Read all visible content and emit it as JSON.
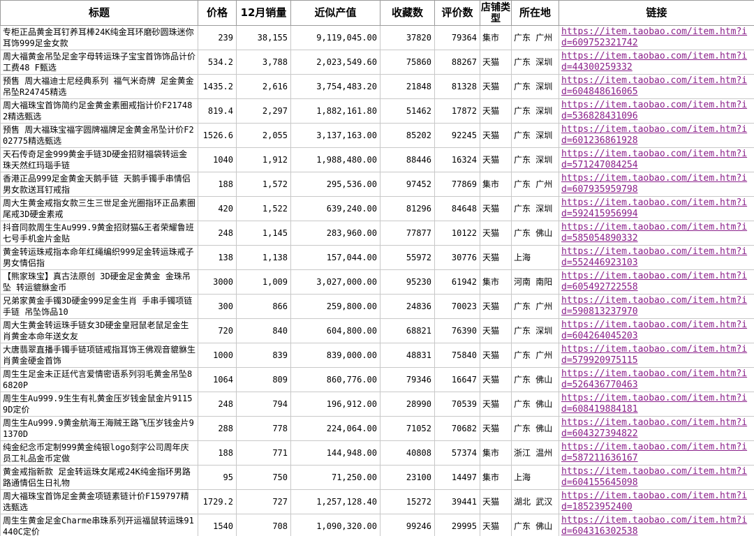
{
  "headers": [
    "标题",
    "价格",
    "12月销量",
    "近似产值",
    "收藏数",
    "评价数",
    "店铺类型",
    "所在地",
    "链接"
  ],
  "rows": [
    {
      "title": "专柜正品黄金耳钉养耳棒24K纯金耳环磨砂圆珠迷你耳饰999足金女款",
      "price": "239",
      "sales": "38,155",
      "value": "9,119,045.00",
      "fav": "37820",
      "reviews": "79364",
      "type": "集市",
      "loc": "广东 广州",
      "link": "https://item.taobao.com/item.htm?id=609752321742"
    },
    {
      "title": "周大福黄金吊坠足金字母转运珠子宝宝首饰饰品计价工费48 F甄选",
      "price": "534.2",
      "sales": "3,788",
      "value": "2,023,549.60",
      "fav": "75860",
      "reviews": "88267",
      "type": "天猫",
      "loc": "广东 深圳",
      "link": "https://item.taobao.com/item.htm?id=44300259332"
    },
    {
      "title": "预售 周大福迪士尼经典系列 福气米奇牌 足金黄金吊坠R24745精选",
      "price": "1435.2",
      "sales": "2,616",
      "value": "3,754,483.20",
      "fav": "21848",
      "reviews": "81328",
      "type": "天猫",
      "loc": "广东 深圳",
      "link": "https://item.taobao.com/item.htm?id=604848616065"
    },
    {
      "title": "周大福珠宝首饰简约足金黄金素圈戒指计价F217482精选甄选",
      "price": "819.4",
      "sales": "2,297",
      "value": "1,882,161.80",
      "fav": "51462",
      "reviews": "17872",
      "type": "天猫",
      "loc": "广东 深圳",
      "link": "https://item.taobao.com/item.htm?id=536828431096"
    },
    {
      "title": "预售 周大福珠宝福字圆牌福牌足金黄金吊坠计价F202775精选甄选",
      "price": "1526.6",
      "sales": "2,055",
      "value": "3,137,163.00",
      "fav": "85202",
      "reviews": "92245",
      "type": "天猫",
      "loc": "广东 深圳",
      "link": "https://item.taobao.com/item.htm?id=601236861928"
    },
    {
      "title": "天石传奇足金999黄金手链3D硬金招财福袋转运金珠天然红玛瑙手链",
      "price": "1040",
      "sales": "1,912",
      "value": "1,988,480.00",
      "fav": "88446",
      "reviews": "16324",
      "type": "天猫",
      "loc": "广东 深圳",
      "link": "https://item.taobao.com/item.htm?id=571247084254"
    },
    {
      "title": "香港正品999足金黄金天鹅手链 天鹅手镯手串情侣男女款送耳钉戒指",
      "price": "188",
      "sales": "1,572",
      "value": "295,536.00",
      "fav": "97452",
      "reviews": "77869",
      "type": "集市",
      "loc": "广东 广州",
      "link": "https://item.taobao.com/item.htm?id=607935959798"
    },
    {
      "title": "周大生黄金戒指女款三生三世足金光圈指环正品素圈尾戒3D硬金素戒",
      "price": "420",
      "sales": "1,522",
      "value": "639,240.00",
      "fav": "81296",
      "reviews": "84648",
      "type": "天猫",
      "loc": "广东 深圳",
      "link": "https://item.taobao.com/item.htm?id=592415956994"
    },
    {
      "title": "抖音同款周生生Au999.9黄金招财猫&王者荣耀鲁班七号手机金片金贴",
      "price": "248",
      "sales": "1,145",
      "value": "283,960.00",
      "fav": "77877",
      "reviews": "10122",
      "type": "天猫",
      "loc": "广东 佛山",
      "link": "https://item.taobao.com/item.htm?id=585054890332"
    },
    {
      "title": "黄金转运珠戒指本命年红绳编织999足金转运珠戒子男女情侣指",
      "price": "138",
      "sales": "1,138",
      "value": "157,044.00",
      "fav": "55972",
      "reviews": "30776",
      "type": "天猫",
      "loc": "上海",
      "link": "https://item.taobao.com/item.htm?id=552446923103"
    },
    {
      "title": "【熊家珠宝】真古法原创 3D硬金足金黄金 金珠吊坠 转运貔貅金币",
      "price": "3000",
      "sales": "1,009",
      "value": "3,027,000.00",
      "fav": "95230",
      "reviews": "61942",
      "type": "集市",
      "loc": "河南 南阳",
      "link": "https://item.taobao.com/item.htm?id=605492722558"
    },
    {
      "title": "兄弟家黄金手镯3D硬金999足金生肖 手串手镯项链 手链 吊坠饰品10",
      "price": "300",
      "sales": "866",
      "value": "259,800.00",
      "fav": "24836",
      "reviews": "70023",
      "type": "天猫",
      "loc": "广东 广州",
      "link": "https://item.taobao.com/item.htm?id=590813237970"
    },
    {
      "title": "周大生黄金转运珠手链女3D硬金皇冠鼠老鼠足金生肖黄金本命年送女友",
      "price": "720",
      "sales": "840",
      "value": "604,800.00",
      "fav": "68821",
      "reviews": "76390",
      "type": "天猫",
      "loc": "广东 深圳",
      "link": "https://item.taobao.com/item.htm?id=604264045203"
    },
    {
      "title": "大唐翡翠直播手镯手链项链戒指耳饰王佛观音貔貅生肖黄金硬金首饰",
      "price": "1000",
      "sales": "839",
      "value": "839,000.00",
      "fav": "48831",
      "reviews": "75840",
      "type": "天猫",
      "loc": "广东 广州",
      "link": "https://item.taobao.com/item.htm?id=579920975115"
    },
    {
      "title": "周生生足金未正廷代言爱情密语系列羽毛黄金吊坠86820P",
      "price": "1064",
      "sales": "809",
      "value": "860,776.00",
      "fav": "79346",
      "reviews": "16647",
      "type": "天猫",
      "loc": "广东 佛山",
      "link": "https://item.taobao.com/item.htm?id=526436770463"
    },
    {
      "title": "周生生Au999.9生生有礼黄金压岁钱金鼠金片91159D定价",
      "price": "248",
      "sales": "794",
      "value": "196,912.00",
      "fav": "28990",
      "reviews": "70539",
      "type": "天猫",
      "loc": "广东 佛山",
      "link": "https://item.taobao.com/item.htm?id=608419884181"
    },
    {
      "title": "周生生Au999.9黄金航海王海贼王路飞压岁钱金片91370D",
      "price": "288",
      "sales": "778",
      "value": "224,064.00",
      "fav": "71052",
      "reviews": "70682",
      "type": "天猫",
      "loc": "广东 佛山",
      "link": "https://item.taobao.com/item.htm?id=604327394822"
    },
    {
      "title": "纯金纪念币定制999黄金纯银logo刻字公司周年庆员工礼品金币定做",
      "price": "188",
      "sales": "771",
      "value": "144,948.00",
      "fav": "40808",
      "reviews": "57374",
      "type": "集市",
      "loc": "浙江 温州",
      "link": "https://item.taobao.com/item.htm?id=587211636167"
    },
    {
      "title": "黄金戒指新款 足金转运珠女尾戒24K纯金指环男路路通情侣生日礼物",
      "price": "95",
      "sales": "750",
      "value": "71,250.00",
      "fav": "23100",
      "reviews": "14497",
      "type": "集市",
      "loc": "上海",
      "link": "https://item.taobao.com/item.htm?id=604155645098"
    },
    {
      "title": "周大福珠宝首饰足金黄金项链素链计价F159797精选甄选",
      "price": "1729.2",
      "sales": "727",
      "value": "1,257,128.40",
      "fav": "15272",
      "reviews": "39441",
      "type": "天猫",
      "loc": "湖北 武汉",
      "link": "https://item.taobao.com/item.htm?id=18523952400"
    },
    {
      "title": "周生生黄金足金Charme串珠系列开运福鼠转运珠91440C定价",
      "price": "1540",
      "sales": "708",
      "value": "1,090,320.00",
      "fav": "99246",
      "reviews": "29995",
      "type": "天猫",
      "loc": "广东 佛山",
      "link": "https://item.taobao.com/item.htm?id=604316302538"
    }
  ]
}
